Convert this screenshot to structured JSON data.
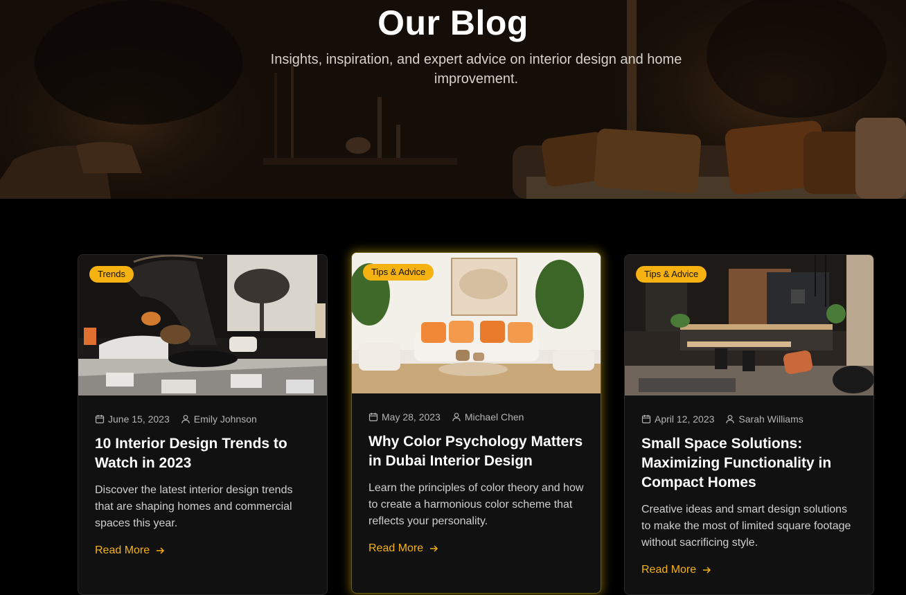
{
  "hero": {
    "title": "Our Blog",
    "subtitle": "Insights, inspiration, and expert advice on interior design and home improvement."
  },
  "colors": {
    "accent": "#f5b210",
    "card_bg": "#111111",
    "page_bg": "#000000"
  },
  "posts": [
    {
      "category": "Trends",
      "date": "June 15, 2023",
      "author": "Emily Johnson",
      "title": "10 Interior Design Trends to Watch in 2023",
      "excerpt": "Discover the latest interior design trends that are shaping homes and commercial spaces this year.",
      "cta": "Read More"
    },
    {
      "category": "Tips & Advice",
      "date": "May 28, 2023",
      "author": "Michael Chen",
      "title": "Why Color Psychology Matters in Dubai Interior Design",
      "excerpt": "Learn the principles of color theory and how to create a harmonious color scheme that reflects your personality.",
      "cta": "Read More"
    },
    {
      "category": "Tips & Advice",
      "date": "April 12, 2023",
      "author": "Sarah Williams",
      "title": "Small Space Solutions: Maximizing Functionality in Compact Homes",
      "excerpt": "Creative ideas and smart design solutions to make the most of limited square footage without sacrificing style.",
      "cta": "Read More"
    }
  ]
}
